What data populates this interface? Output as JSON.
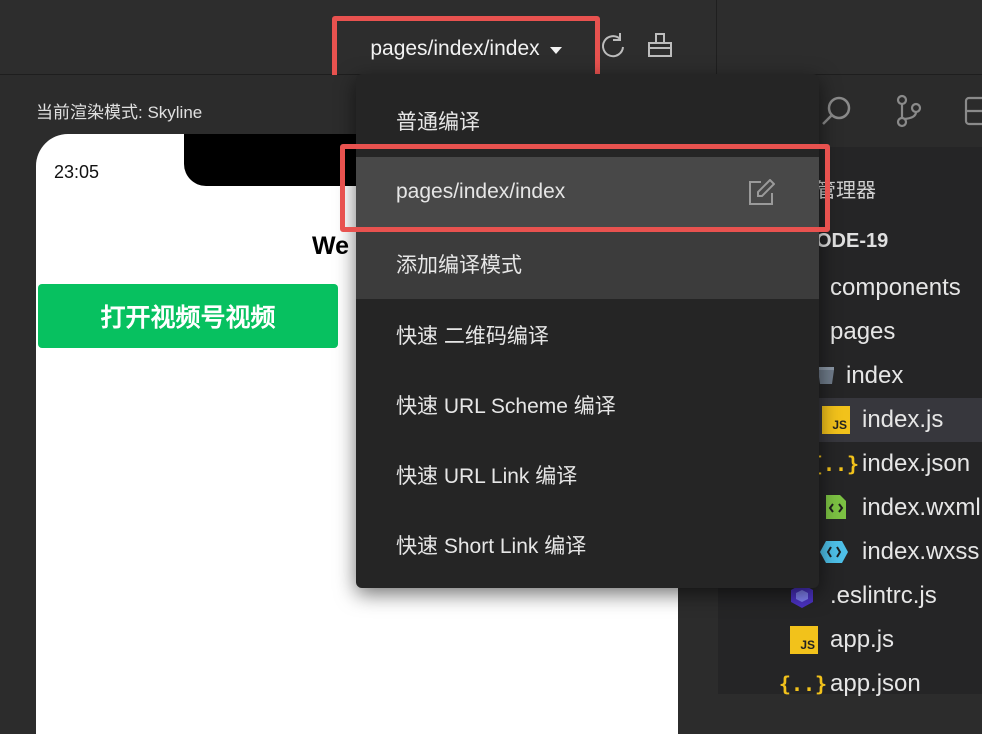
{
  "toolbar": {
    "compile_target": "pages/index/index",
    "icons": [
      "refresh-icon",
      "clear-cache-icon"
    ]
  },
  "simulator": {
    "render_mode": "当前渲染模式: Skyline",
    "status_time": "23:05",
    "heading": "We",
    "green_button": "打开视频号视频"
  },
  "dropdown": {
    "items": [
      {
        "label": "普通编译"
      },
      {
        "label": "pages/index/index",
        "icon": "edit-icon"
      },
      {
        "label": "添加编译模式"
      },
      {
        "label": "快速 二维码编译"
      },
      {
        "label": "快速 URL Scheme 编译"
      },
      {
        "label": "快速 URL Link 编译"
      },
      {
        "label": "快速 Short Link 编译"
      }
    ]
  },
  "explorer": {
    "title": "管理器",
    "project": "ODE-19",
    "tree": [
      {
        "label": "components",
        "icon": "folder"
      },
      {
        "label": "pages",
        "icon": "folder"
      },
      {
        "label": "index",
        "icon": "folder-open-icon"
      },
      {
        "label": "index.js",
        "icon": "js-file-icon"
      },
      {
        "label": "index.json",
        "icon": "json-file-icon"
      },
      {
        "label": "index.wxml",
        "icon": "wxml-file-icon"
      },
      {
        "label": "index.wxss",
        "icon": "wxss-file-icon"
      },
      {
        "label": ".eslintrc.js",
        "icon": "eslint-icon"
      },
      {
        "label": "app.js",
        "icon": "js-file-icon"
      },
      {
        "label": "app.json",
        "icon": "json-file-icon"
      }
    ]
  },
  "colors": {
    "highlight_border": "#e8524f",
    "primary_green": "#07c160",
    "js_yellow": "#f2c21b"
  }
}
